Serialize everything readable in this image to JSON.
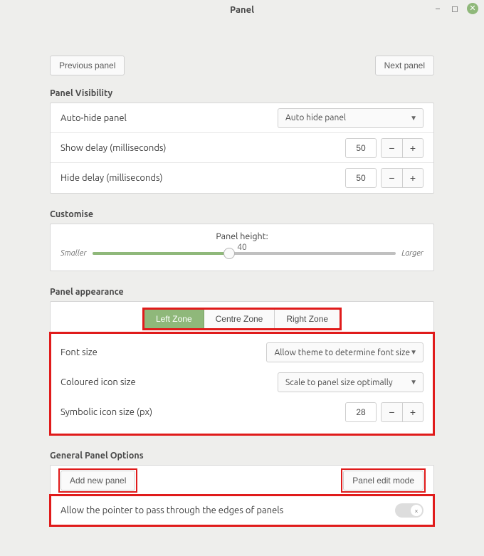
{
  "titlebar": {
    "title": "Panel"
  },
  "nav": {
    "prev": "Previous panel",
    "next": "Next panel"
  },
  "visibility": {
    "heading": "Panel Visibility",
    "autohide_label": "Auto-hide panel",
    "autohide_value": "Auto hide panel",
    "show_delay_label": "Show delay (milliseconds)",
    "show_delay_value": "50",
    "hide_delay_label": "Hide delay (milliseconds)",
    "hide_delay_value": "50"
  },
  "customise": {
    "heading": "Customise",
    "panel_height_label": "Panel height:",
    "panel_height_value": "40",
    "smaller": "Smaller",
    "larger": "Larger",
    "slider_percent": 45
  },
  "appearance": {
    "heading": "Panel appearance",
    "tabs": {
      "left": "Left Zone",
      "centre": "Centre Zone",
      "right": "Right Zone"
    },
    "font_size_label": "Font size",
    "font_size_value": "Allow theme to determine font size",
    "coloured_icon_label": "Coloured icon size",
    "coloured_icon_value": "Scale to panel size optimally",
    "symbolic_icon_label": "Symbolic icon size (px)",
    "symbolic_icon_value": "28"
  },
  "general": {
    "heading": "General Panel Options",
    "add_panel": "Add new panel",
    "edit_mode": "Panel edit mode",
    "pointer_pass_label": "Allow the pointer to pass through the edges of panels"
  }
}
